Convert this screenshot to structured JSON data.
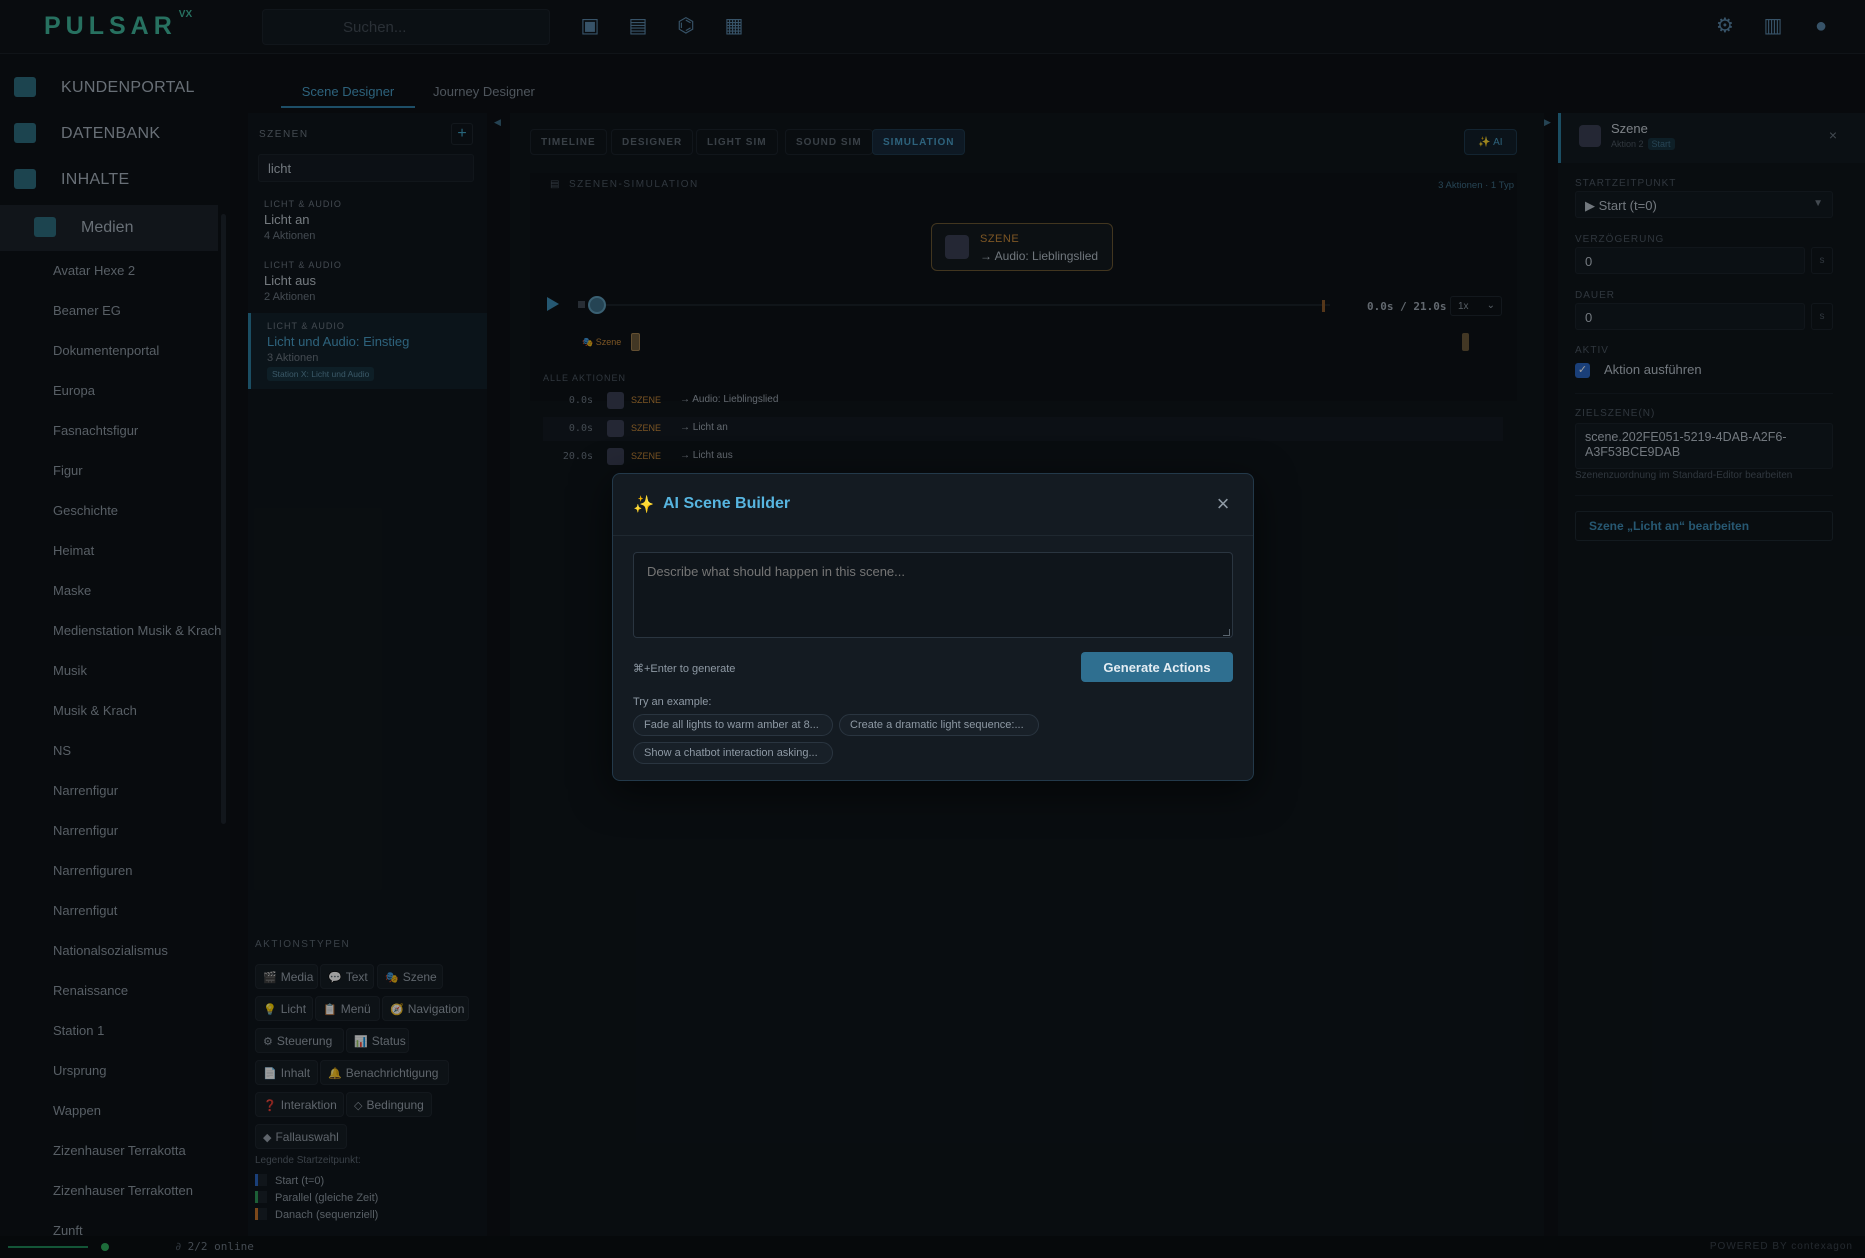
{
  "app": {
    "logo": "PULSAR",
    "logo_suffix": "VX",
    "search_placeholder": "Suchen..."
  },
  "colors": {
    "accent": "#4a9fc8",
    "brand": "#3fb79c",
    "scene_orange": "#c88a3a",
    "start_blue": "#2a67c4",
    "parallel_green": "#2f9a5a",
    "seq_orange": "#c8742a"
  },
  "icons": {
    "top": [
      "image-add-icon",
      "clapperboard-icon",
      "remote-icon",
      "grid-icon"
    ],
    "top_right": [
      "gear-icon",
      "chart-icon",
      "user-icon"
    ]
  },
  "nav": {
    "main": [
      {
        "label": "KUNDENPORTAL",
        "icon": "folder-icon"
      },
      {
        "label": "DATENBANK",
        "icon": "database-icon"
      },
      {
        "label": "INHALTE",
        "icon": "images-icon"
      }
    ],
    "sub": {
      "label": "Medien",
      "icon": "images-icon"
    },
    "media_items": [
      "Avatar Hexe 2",
      "Beamer EG",
      "Dokumentenportal",
      "Europa",
      "Fasnachtsfigur",
      "Figur",
      "Geschichte",
      "Heimat",
      "Maske",
      "Medienstation Musik & Krach",
      "Musik",
      "Musik & Krach",
      "NS",
      "Narrenfigur",
      "Narrenfigur",
      "Narrenfiguren",
      "Narrenfigut",
      "Nationalsozialismus",
      "Renaissance",
      "Station 1",
      "Ursprung",
      "Wappen",
      "Zizenhauser Terrakotta",
      "Zizenhauser Terrakotten",
      "Zunft"
    ]
  },
  "tabs": {
    "scene": "Scene Designer",
    "journey": "Journey Designer"
  },
  "scenes": {
    "header": "SZENEN",
    "add": "+",
    "search_value": "licht",
    "items": [
      {
        "category": "LICHT & AUDIO",
        "name": "Licht an",
        "count": "4 Aktionen"
      },
      {
        "category": "LICHT & AUDIO",
        "name": "Licht aus",
        "count": "2 Aktionen"
      },
      {
        "category": "LICHT & AUDIO",
        "name": "Licht und Audio: Einstieg",
        "count": "3 Aktionen",
        "tag": "Station X: Licht und Audio"
      }
    ]
  },
  "aktionstypen": {
    "header": "AKTIONSTYPEN",
    "chips": [
      {
        "e": "🎬",
        "label": "Media"
      },
      {
        "e": "💬",
        "label": "Text"
      },
      {
        "e": "🎭",
        "label": "Szene"
      },
      {
        "e": "💡",
        "label": "Licht"
      },
      {
        "e": "📋",
        "label": "Menü"
      },
      {
        "e": "🧭",
        "label": "Navigation"
      },
      {
        "e": "⚙",
        "label": "Steuerung"
      },
      {
        "e": "📊",
        "label": "Status"
      },
      {
        "e": "📄",
        "label": "Inhalt"
      },
      {
        "e": "🔔",
        "label": "Benachrichtigung"
      },
      {
        "e": "❓",
        "label": "Interaktion"
      },
      {
        "e": "◇",
        "label": "Bedingung"
      },
      {
        "e": "◆",
        "label": "Fallauswahl"
      }
    ]
  },
  "legend": {
    "header": "Legende Startzeitpunkt:",
    "items": [
      {
        "label": "Start (t=0)",
        "color": "#2a67c4"
      },
      {
        "label": "Parallel (gleiche Zeit)",
        "color": "#2f9a5a"
      },
      {
        "label": "Danach (sequenziell)",
        "color": "#c8742a"
      }
    ]
  },
  "sim": {
    "tabs": [
      "TIMELINE",
      "DESIGNER",
      "LIGHT SIM",
      "SOUND SIM",
      "SIMULATION"
    ],
    "ai_label": "✨ AI",
    "title": "SZENEN-SIMULATION",
    "meta": "3 Aktionen · 1 Typ",
    "node_kind": "SZENE",
    "node_value": "→ Audio: Lieblingslied",
    "time": "0.0s / 21.0s",
    "speed": "1x",
    "track_label": "Szene",
    "all_header": "ALLE AKTIONEN",
    "actions": [
      {
        "t": "0.0s",
        "kind": "SZENE",
        "value": "→ Audio: Lieblingslied"
      },
      {
        "t": "0.0s",
        "kind": "SZENE",
        "value": "→ Licht an"
      },
      {
        "t": "20.0s",
        "kind": "SZENE",
        "value": "→ Licht aus"
      }
    ]
  },
  "right": {
    "title": "Szene",
    "sub": "Aktion 2",
    "badge": "Start",
    "close": "×",
    "start_label": "STARTZEITPUNKT",
    "start_value": "▶ Start (t=0)",
    "delay_label": "VERZÖGERUNG",
    "delay_value": "0",
    "duration_label": "DAUER",
    "duration_value": "0",
    "unit": "s",
    "active_label": "AKTIV",
    "active_check": "Aktion ausführen",
    "target_label": "ZIELSZENE(N)",
    "target_value": "scene.202FE051-5219-4DAB-A2F6-A3F53BCE9DAB",
    "target_hint": "Szenenzuordnung im Standard-Editor bearbeiten",
    "edit_button": "Szene „Licht an“ bearbeiten"
  },
  "modal": {
    "spark": "✨",
    "title": "AI Scene Builder",
    "close": "×",
    "placeholder": "Describe what should happen in this scene...",
    "shortcut": "⌘+Enter to generate",
    "generate": "Generate Actions",
    "try_label": "Try an example:",
    "examples": [
      "Fade all lights to warm amber at 8...",
      "Create a dramatic light sequence:...",
      "Show a chatbot interaction asking..."
    ]
  },
  "status": {
    "online": "2/2 online",
    "powered": "POWERED BY  contexagon"
  }
}
